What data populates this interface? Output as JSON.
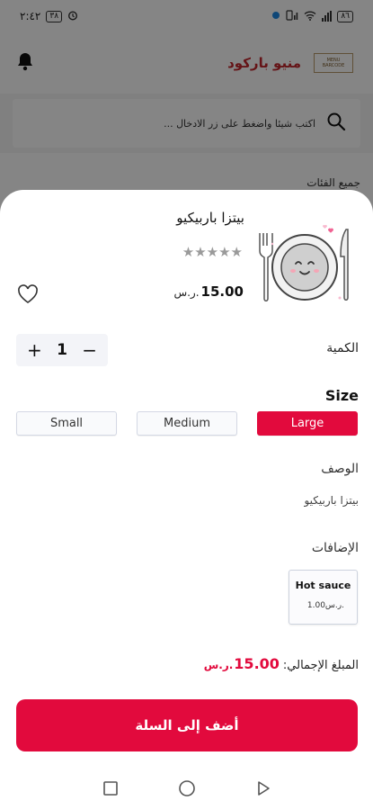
{
  "status_bar": {
    "time": "٢:٤٢",
    "sim_badge": "٣٨",
    "battery": "٨٦"
  },
  "app_bar": {
    "brand": "منيو باركود",
    "logo_text": "MENU BARCODE"
  },
  "search": {
    "placeholder": "اكتب شيئا واضغط على زر الادخال ..."
  },
  "categories_label": "جميع الفئات",
  "product": {
    "name": "بيتزا باربيكيو",
    "rating": 0,
    "stars": "★★★★★",
    "price_value": "15.00",
    "currency": "ر.س."
  },
  "quantity": {
    "label": "الكمية",
    "value": "1",
    "plus": "+",
    "minus": "−"
  },
  "size": {
    "title": "Size",
    "options": [
      "Large",
      "Medium",
      "Small"
    ],
    "selected": "Large"
  },
  "description": {
    "label": "الوصف",
    "text": "بيتزا باربيكيو"
  },
  "addons": {
    "label": "الإضافات",
    "items": [
      {
        "name": "Hot sauce",
        "price": "1.00ر.س."
      }
    ]
  },
  "total": {
    "label": "المبلغ الإجمالي:",
    "value": "15.00",
    "currency": "ر.س."
  },
  "add_to_cart_label": "أضف إلى السلة",
  "colors": {
    "accent": "#e20a3d",
    "brand": "#c2272d"
  }
}
